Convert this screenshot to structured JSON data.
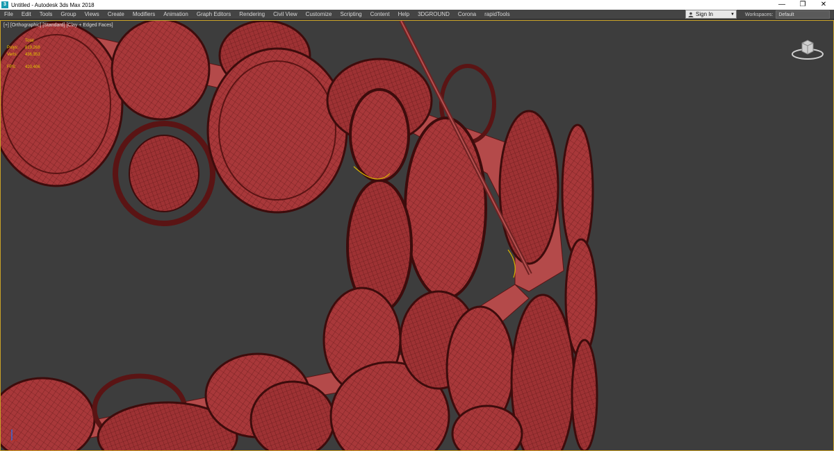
{
  "window": {
    "title": "Untitled - Autodesk 3ds Max 2018",
    "app_icon": "3",
    "buttons": {
      "minimize": "—",
      "restore": "❐",
      "close": "✕"
    }
  },
  "menus": [
    {
      "label": "File"
    },
    {
      "label": "Edit"
    },
    {
      "label": "Tools"
    },
    {
      "label": "Group"
    },
    {
      "label": "Views"
    },
    {
      "label": "Create"
    },
    {
      "label": "Modifiers"
    },
    {
      "label": "Animation"
    },
    {
      "label": "Graph Editors"
    },
    {
      "label": "Rendering"
    },
    {
      "label": "Civil View"
    },
    {
      "label": "Customize"
    },
    {
      "label": "Scripting"
    },
    {
      "label": "Content"
    },
    {
      "label": "Help"
    },
    {
      "label": "3DGROUND"
    },
    {
      "label": "Corona"
    },
    {
      "label": "rapidTools"
    }
  ],
  "account": {
    "sign_in": "Sign In"
  },
  "workspaces": {
    "label": "Workspaces:",
    "value": "Default"
  },
  "viewport": {
    "label": "[+] [Orthographic] [Standard] [Clay + Edged Faces]",
    "stats": {
      "header": "Total",
      "polys_label": "Polys:",
      "polys": "819,268",
      "verts_label": "Verts:",
      "verts": "436,353",
      "fps_label": "FPS:",
      "fps": "420,406"
    }
  },
  "colors": {
    "viewport_bg": "#3d3d3d",
    "clay": "#a8383a",
    "clay_dark": "#5a1414",
    "viewport_border": "#c9a227",
    "stats": "#e6c800"
  }
}
